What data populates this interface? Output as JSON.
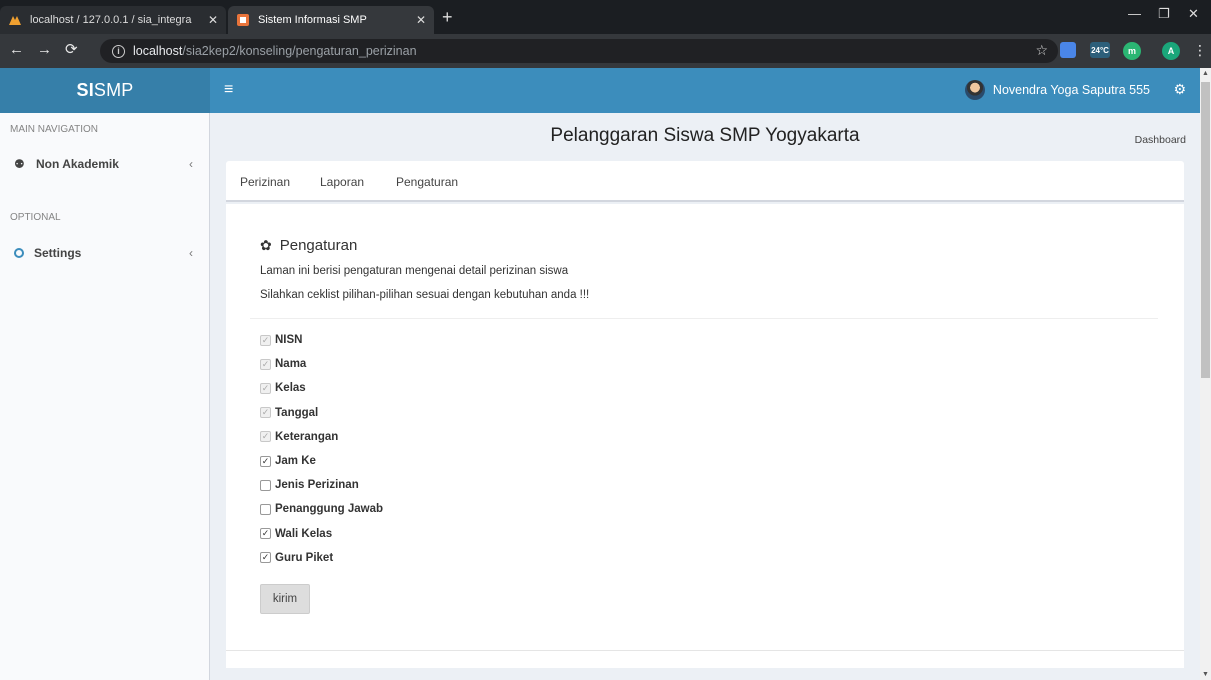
{
  "browser": {
    "tabs": [
      {
        "title": "localhost / 127.0.0.1 / sia_integra",
        "active": false
      },
      {
        "title": "Sistem Informasi SMP",
        "active": true
      }
    ],
    "url_host": "localhost",
    "url_path": "/sia2kep2/konseling/pengaturan_perizinan",
    "extensions": [
      {
        "icon": "docs-extension-icon",
        "label": ""
      },
      {
        "icon": "weather-extension-icon",
        "label": "24°C"
      },
      {
        "icon": "m-extension-icon",
        "label": "m"
      },
      {
        "icon": "profile-avatar-icon",
        "label": "A"
      }
    ]
  },
  "app": {
    "logo_bold": "SI",
    "logo_rest": "SMP",
    "user_name": "Novendra Yoga Saputra 555",
    "brand_color": "#3c8dbc"
  },
  "sidebar": {
    "main_header": "MAIN NAVIGATION",
    "optional_header": "OPTIONAL",
    "items": [
      {
        "label": "Non Akademik",
        "icon": "group-icon"
      },
      {
        "label": "Settings",
        "icon": "circle-icon"
      }
    ]
  },
  "content": {
    "title": "Pelanggaran Siswa SMP Yogyakarta",
    "breadcrumb": "Dashboard",
    "tabs": [
      "Perizinan",
      "Laporan",
      "Pengaturan"
    ],
    "section_title": "Pengaturan",
    "desc1": "Laman ini berisi pengaturan mengenai detail perizinan siswa",
    "desc2": "Silahkan ceklist pilihan-pilihan sesuai dengan kebutuhan anda !!!",
    "options": [
      {
        "label": "NISN",
        "checked": true,
        "disabled": true
      },
      {
        "label": "Nama",
        "checked": true,
        "disabled": true
      },
      {
        "label": "Kelas",
        "checked": true,
        "disabled": true
      },
      {
        "label": "Tanggal",
        "checked": true,
        "disabled": true
      },
      {
        "label": "Keterangan",
        "checked": true,
        "disabled": true
      },
      {
        "label": "Jam Ke",
        "checked": true,
        "disabled": false
      },
      {
        "label": "Jenis Perizinan",
        "checked": false,
        "disabled": false
      },
      {
        "label": "Penanggung Jawab",
        "checked": false,
        "disabled": false
      },
      {
        "label": "Wali Kelas",
        "checked": true,
        "disabled": false
      },
      {
        "label": "Guru Piket",
        "checked": true,
        "disabled": false
      }
    ],
    "submit_label": "kirim"
  }
}
